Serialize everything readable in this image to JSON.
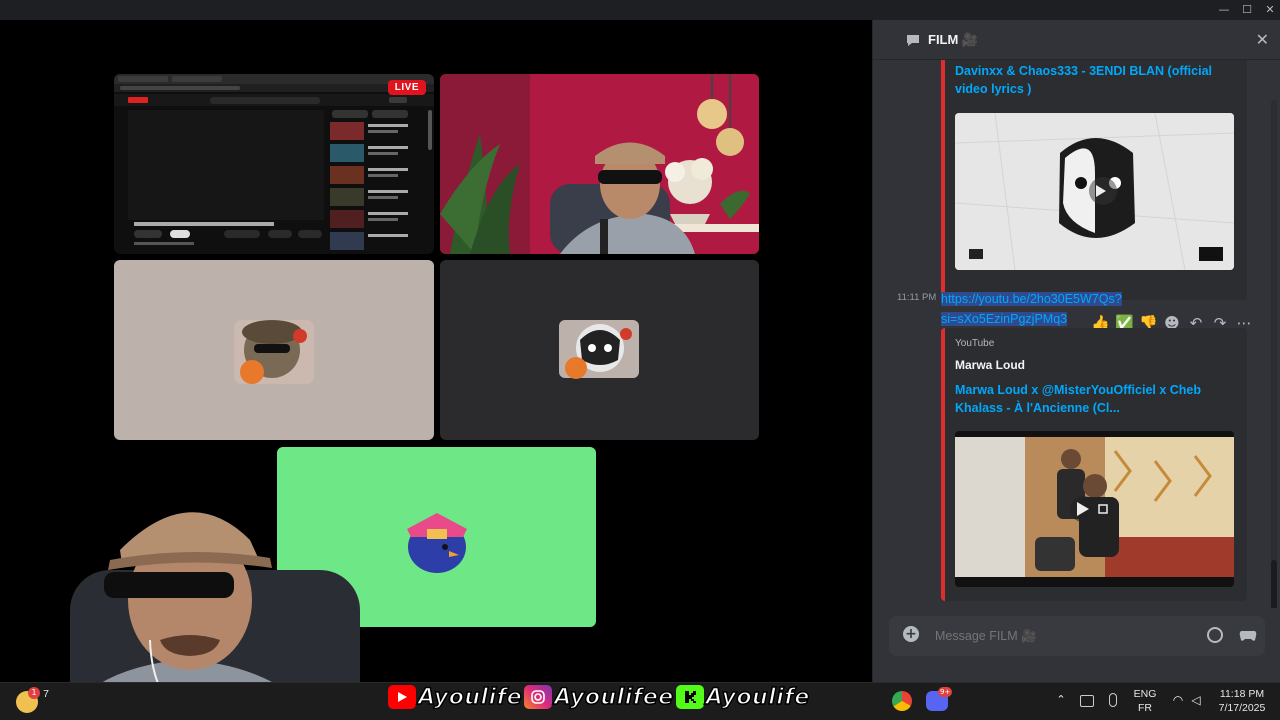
{
  "window": {
    "minimize": "—",
    "maximize": "☐",
    "close": "✕"
  },
  "stage": {
    "live_badge": "LIVE"
  },
  "chat": {
    "channel_title": "FILM 🎥",
    "messages": [
      {
        "embed_title": "Davinxx & Chaos333 - 3ENDI BLAN (official video lyrics )"
      },
      {
        "timestamp": "11:11 PM",
        "link_line1": "https://youtu.be/2ho30E5W7Qs?",
        "link_line2": "si=sXo5EzinPgzjPMq3",
        "embed_provider": "YouTube",
        "embed_author": "Marwa Loud",
        "embed_title": "Marwa Loud x @MisterYouOfficiel  x Cheb Khalass - À l'Ancienne (Cl..."
      }
    ],
    "composer_placeholder": "Message FILM 🎥"
  },
  "overlay": {
    "banner_items": [
      "Ayoulife",
      "Ayoulifee",
      "Ayoulife"
    ]
  },
  "taskbar": {
    "weather_badge": "1",
    "weather_text": "7",
    "lang_line1": "ENG",
    "lang_line2": "FR",
    "time": "11:18 PM",
    "date": "7/17/2025",
    "discord_badge": "9+"
  },
  "colors": {
    "accent_link": "#00a8fc",
    "embed_border": "#e02c2c",
    "live_red": "#e0131f",
    "green_tile": "#6ee886",
    "beige_tile": "#bdb1ab"
  }
}
